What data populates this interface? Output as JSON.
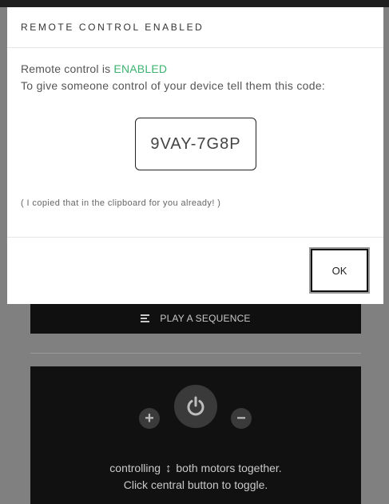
{
  "modal": {
    "title": "REMOTE CONTROL ENABLED",
    "status_prefix": "Remote control is ",
    "status_value": "ENABLED",
    "status_color": "#3cb371",
    "instruction": "To give someone control of your device tell them this code:",
    "code": "9VAY-7G8P",
    "copied_note": "( I copied that in the clipboard for you already! )",
    "ok_label": "OK"
  },
  "background": {
    "sequence_label": "PLAY A SEQUENCE",
    "sequence_icon": "menu-icon",
    "plus_label": "+",
    "minus_label": "−",
    "power_icon": "power-icon",
    "control_line1_prefix": "controlling",
    "control_line1_icon": "↕",
    "control_line1_suffix": "both motors together.",
    "control_line2": "Click central button to toggle."
  }
}
